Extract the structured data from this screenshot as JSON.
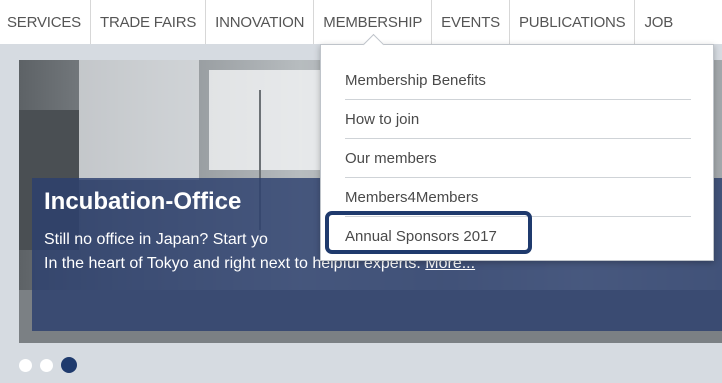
{
  "nav": {
    "items": [
      "SERVICES",
      "TRADE FAIRS",
      "INNOVATION",
      "MEMBERSHIP",
      "EVENTS",
      "PUBLICATIONS",
      "JOB"
    ],
    "active_index": 3
  },
  "dropdown": {
    "items": [
      "Membership Benefits",
      "How to join",
      "Our members",
      "Members4Members",
      "Annual Sponsors 2017"
    ],
    "highlighted_index": 4
  },
  "hero": {
    "title": "Incubation-Office",
    "line1": "Still no office in Japan? Start yo",
    "line2": "In the heart of Tokyo and right next to helpful experts.",
    "more_link": "More..."
  },
  "carousel": {
    "dot_count": 3,
    "active_dot": 3
  },
  "colors": {
    "accent": "#1f3a6d",
    "overlay": "#2c406e",
    "band": "#d6dbe1"
  }
}
